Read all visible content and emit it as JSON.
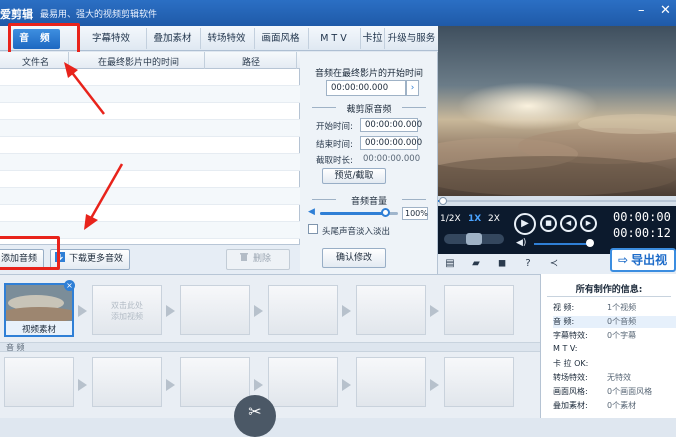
{
  "app": {
    "name": "爱剪辑",
    "slogan": "最易用、强大的视频剪辑软件"
  },
  "tabs": [
    {
      "label": "音 频",
      "active": true
    },
    {
      "label": "字幕特效",
      "visible_text": "字幕特效"
    },
    {
      "label": "叠加素材"
    },
    {
      "label": "转场特效"
    },
    {
      "label": "画面风格"
    },
    {
      "label": "M T V"
    },
    {
      "label": "卡拉OK"
    },
    {
      "label": "升级与服务"
    }
  ],
  "audio_table": {
    "columns": [
      "文件名",
      "在最终影片中的时间",
      "路径"
    ]
  },
  "left_buttons": {
    "add_audio": "添加音频",
    "download_more": "下载更多音效",
    "delete": "删除"
  },
  "audio_panel": {
    "start_time_title": "音频在最终影片的开始时间",
    "start_time_value": "00:00:00.000",
    "crop_section": "裁剪原音频",
    "start_label": "开始时间:",
    "start_value": "00:00:00.000",
    "end_label": "结束时间:",
    "end_value": "00:00:00.000",
    "duration_label": "截取时长:",
    "duration_value": "00:00:00.000",
    "preview_btn": "预览/截取",
    "volume_section": "音频音量",
    "volume_value": "100%",
    "volume_level": 0.85,
    "fade_label": "头尾声音淡入淡出",
    "confirm_btn": "确认修改"
  },
  "player": {
    "speed_options": [
      "1/2X",
      "1X",
      "2X"
    ],
    "time_current": "00:00:00",
    "time_total": "00:00:12",
    "progress": 0.02
  },
  "toolbar": {
    "export_label": "导出视"
  },
  "timeline": {
    "first_clip_label": "视频素材",
    "placeholder": "双击此处\n添加视频",
    "audio_section": "音 频"
  },
  "info": {
    "title": "所有制作的信息:",
    "rows": [
      {
        "k": "视   频:",
        "v": "1个视频"
      },
      {
        "k": "音   频:",
        "v": "0个音频"
      },
      {
        "k": "字幕特效:",
        "v": "0个字幕"
      },
      {
        "k": "M   T   V:",
        "v": ""
      },
      {
        "k": "卡 拉 OK:",
        "v": ""
      },
      {
        "k": "转场特效:",
        "v": "无特效"
      },
      {
        "k": "画面风格:",
        "v": "0个画面风格"
      },
      {
        "k": "叠加素材:",
        "v": "0个素材"
      }
    ]
  },
  "colors": {
    "accent": "#1e6cc9",
    "annotation": "#e8231b"
  }
}
